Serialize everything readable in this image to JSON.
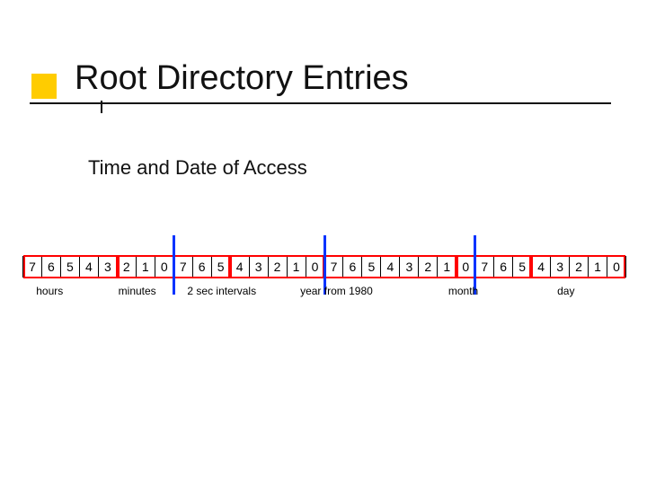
{
  "title": "Root Directory Entries",
  "subtitle": "Time and Date of Access",
  "bits": [
    "7",
    "6",
    "5",
    "4",
    "3",
    "2",
    "1",
    "0",
    "7",
    "6",
    "5",
    "4",
    "3",
    "2",
    "1",
    "0",
    "7",
    "6",
    "5",
    "4",
    "3",
    "2",
    "1",
    "0",
    "7",
    "6",
    "5",
    "4",
    "3",
    "2",
    "1",
    "0"
  ],
  "fields": [
    {
      "label": "hours",
      "start": 0,
      "len": 5
    },
    {
      "label": "minutes",
      "start": 5,
      "len": 6
    },
    {
      "label": "2 sec intervals",
      "start": 11,
      "len": 5
    },
    {
      "label": "year from 1980",
      "start": 16,
      "len": 7
    },
    {
      "label": "month",
      "start": 23,
      "len": 4
    },
    {
      "label": "day",
      "start": 27,
      "len": 5
    }
  ],
  "byte_separators_at_bit_index": [
    8,
    16,
    24
  ],
  "label_positions_pct": [
    4.5,
    19,
    33,
    52,
    73,
    90
  ],
  "colors": {
    "red": "#ff0000",
    "blue": "#0033ff",
    "yellow": "#ffcc00"
  }
}
